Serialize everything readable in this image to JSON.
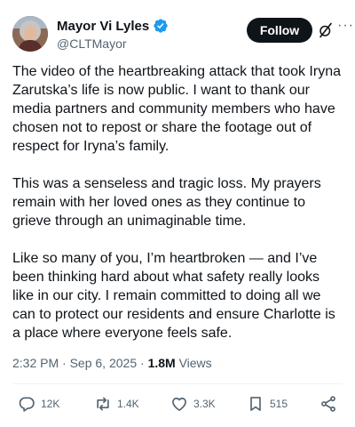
{
  "author": {
    "display_name": "Mayor Vi Lyles",
    "handle": "@CLTMayor",
    "verified": true,
    "verified_badge_color": "#1d9bf0"
  },
  "header": {
    "follow_label": "Follow",
    "grok_icon": "grok-slash-icon",
    "more_icon": "ellipsis-icon",
    "more_glyph": "···"
  },
  "tweet": {
    "paragraphs": [
      "The video of the heartbreaking attack that took Iryna Zarutska’s life is now public. I want to thank our media partners and community members who have chosen not to repost or share the footage out of respect for Iryna’s family.",
      "This was a senseless and tragic loss. My prayers remain with her loved ones as they continue to grieve through an unimaginable time.",
      "Like so many of you, I’m heartbroken — and I’ve been thinking hard about what safety really looks like in our city. I remain committed to doing all we can to protect our residents and ensure Charlotte is a place where everyone feels safe."
    ]
  },
  "meta": {
    "time": "2:32 PM",
    "dot1": "·",
    "date": "Sep 6, 2025",
    "dot2": "·",
    "views_count": "1.8M",
    "views_label": "Views"
  },
  "actions": {
    "replies": "12K",
    "reposts": "1.4K",
    "likes": "3.3K",
    "bookmarks": "515"
  },
  "colors": {
    "text": "#0f1419",
    "secondary": "#536471",
    "follow_bg": "#0f1419",
    "divider": "#eff3f4"
  }
}
